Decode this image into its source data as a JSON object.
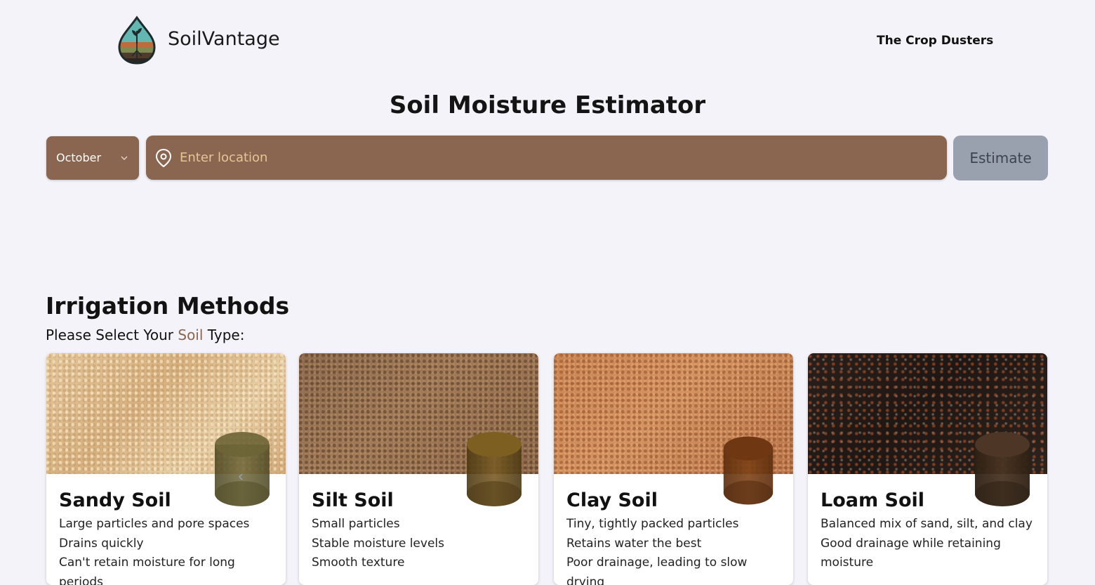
{
  "header": {
    "brand": "SoilVantage",
    "team": "The Crop Dusters"
  },
  "main": {
    "title": "Soil Moisture Estimator",
    "month_select": {
      "value": "October"
    },
    "location_input": {
      "placeholder": "Enter location",
      "value": ""
    },
    "estimate_label": "Estimate"
  },
  "irrigation": {
    "title": "Irrigation Methods",
    "prompt_before": "Please Select Your ",
    "prompt_accent": "Soil",
    "prompt_after": " Type:",
    "cards": [
      {
        "title": "Sandy Soil",
        "points": [
          "Large particles and pore spaces",
          "Drains quickly",
          "Can't retain moisture for long periods"
        ],
        "cylinder_color": "#5b5530"
      },
      {
        "title": "Silt Soil",
        "points": [
          "Small particles",
          "Stable moisture levels",
          "Smooth texture"
        ],
        "cylinder_color": "#6b5220"
      },
      {
        "title": "Clay Soil",
        "points": [
          "Tiny, tightly packed particles",
          "Retains water the best",
          "Poor drainage, leading to slow drying"
        ],
        "cylinder_color": "#6a3510"
      },
      {
        "title": "Loam Soil",
        "points": [
          "Balanced mix of sand, silt, and clay",
          "Good drainage while retaining",
          "moisture"
        ],
        "cylinder_color": "#3d2a1a"
      }
    ]
  },
  "colors": {
    "background": "#f4f3f9",
    "input_brown": "#8a6650",
    "placeholder": "#e6c595",
    "estimate_button": "#9aa1ae"
  }
}
